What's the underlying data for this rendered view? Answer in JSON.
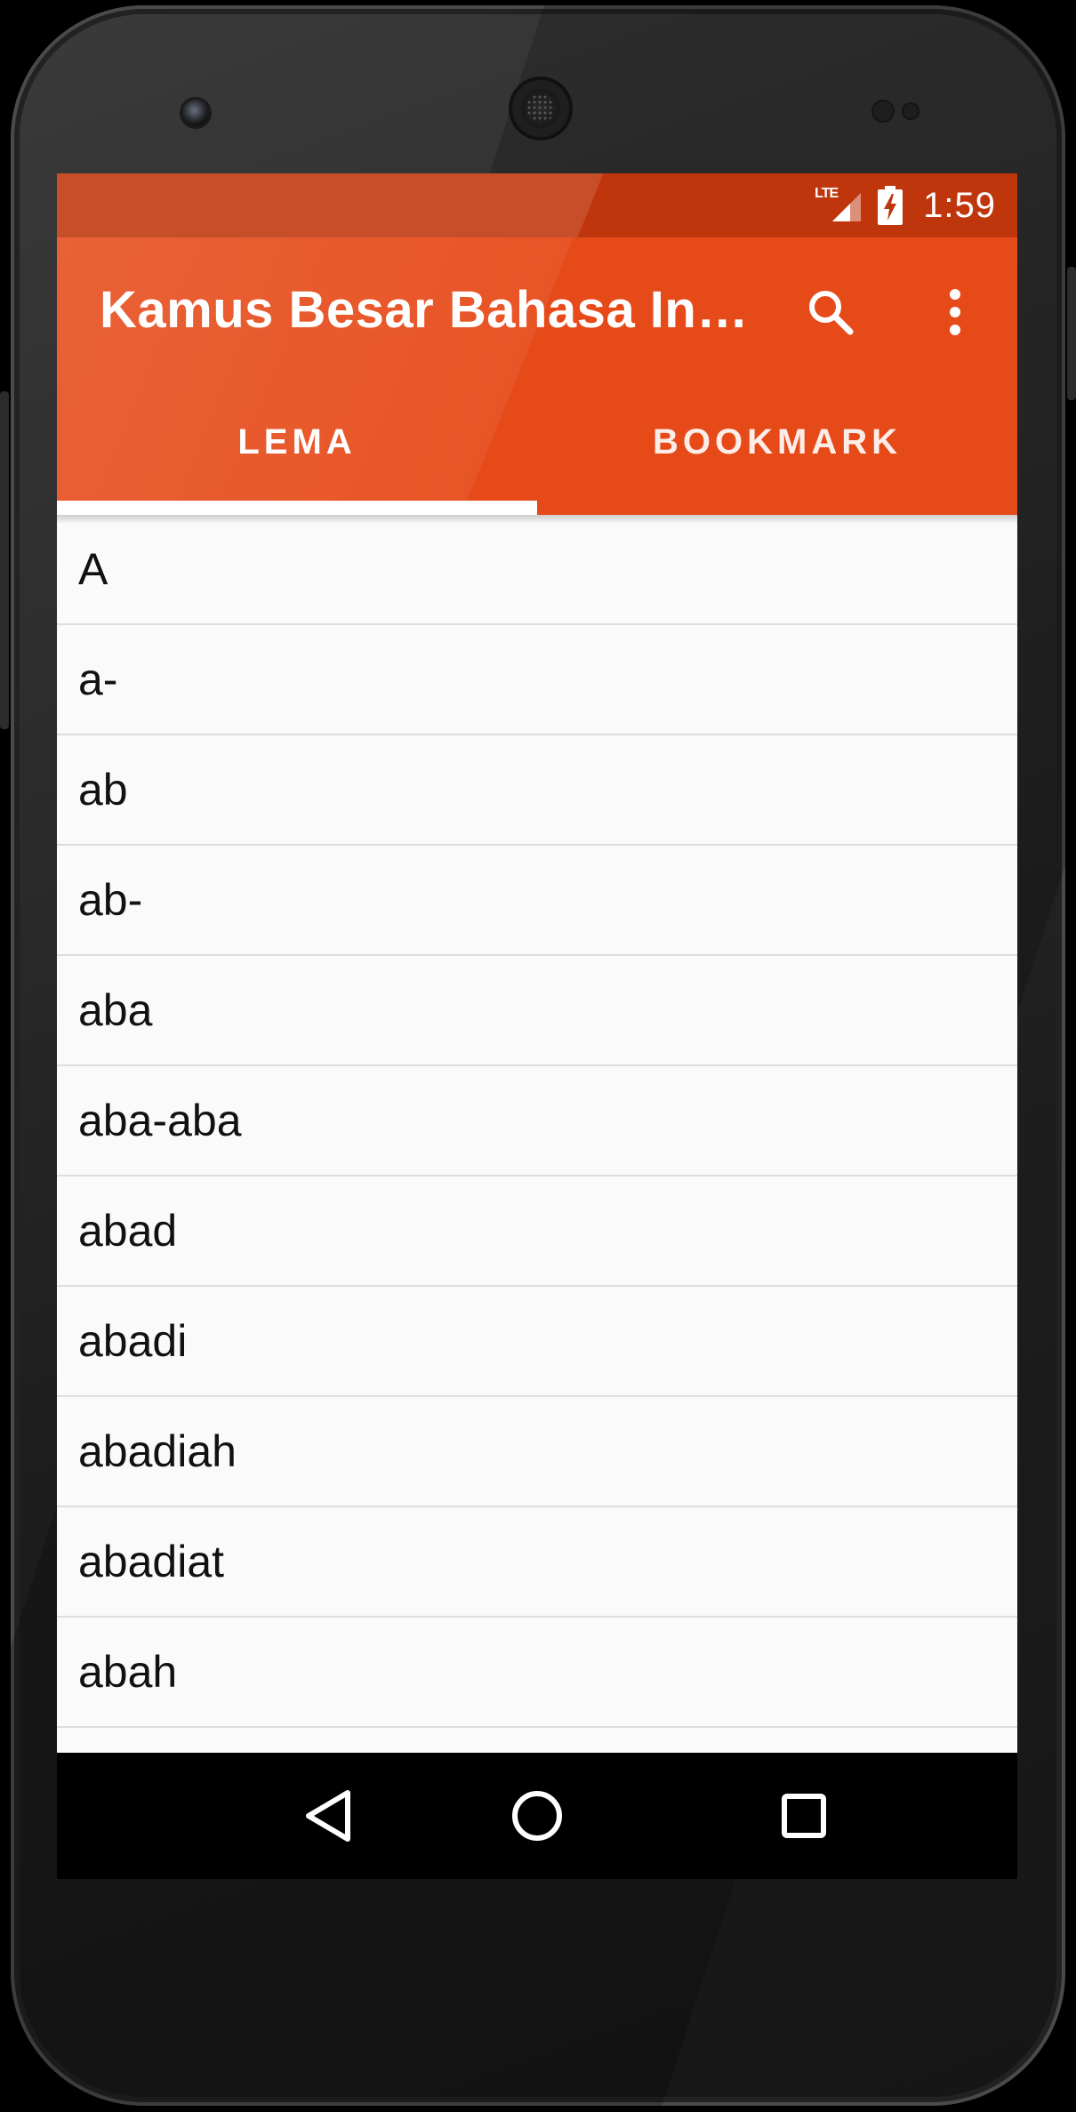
{
  "status_bar": {
    "network": "LTE",
    "time": "1:59"
  },
  "app_bar": {
    "title": "Kamus Besar Bahasa Ind…",
    "actions": [
      "search-icon",
      "more-vert-icon"
    ],
    "color": "#e64a19",
    "status_color": "#bf360c"
  },
  "tabs": [
    {
      "label": "LEMA",
      "selected": true
    },
    {
      "label": "BOOKMARK",
      "selected": false
    }
  ],
  "list": {
    "items": [
      "A",
      "a-",
      "ab",
      "ab-",
      "aba",
      "aba-aba",
      "abad",
      "abadi",
      "abadiah",
      "abadiat",
      "abah"
    ]
  },
  "nav_bar": {
    "buttons": [
      "back-icon",
      "home-icon",
      "recents-icon"
    ]
  }
}
